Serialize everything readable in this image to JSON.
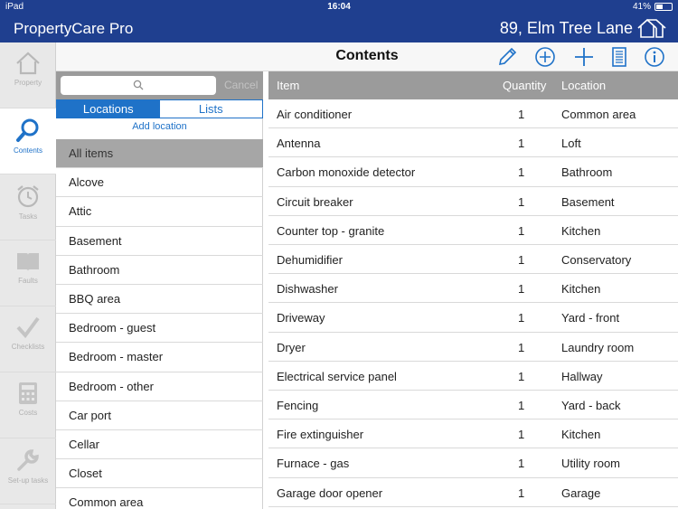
{
  "status": {
    "device": "iPad",
    "time": "16:04",
    "battery": "41%"
  },
  "app": {
    "title": "PropertyCare Pro",
    "address": "89, Elm Tree Lane"
  },
  "rail": [
    {
      "label": "Property",
      "icon": "house-icon"
    },
    {
      "label": "Contents",
      "icon": "magnifier-icon",
      "active": true
    },
    {
      "label": "Tasks",
      "icon": "alarm-clock-icon"
    },
    {
      "label": "Faults",
      "icon": "book-icon"
    },
    {
      "label": "Checklists",
      "icon": "checkmark-icon"
    },
    {
      "label": "Costs",
      "icon": "calculator-icon"
    },
    {
      "label": "Set-up tasks",
      "icon": "wrench-icon"
    }
  ],
  "toolbar": {
    "title": "Contents",
    "icons": [
      "pencil-icon",
      "add-circle-icon",
      "plus-icon",
      "report-icon",
      "info-icon"
    ]
  },
  "search": {
    "placeholder": "",
    "cancel_label": "Cancel"
  },
  "segments": {
    "locations": "Locations",
    "lists": "Lists"
  },
  "add_location": "Add location",
  "locations": [
    "All items",
    "Alcove",
    "Attic",
    "Basement",
    "Bathroom",
    "BBQ area",
    "Bedroom - guest",
    "Bedroom - master",
    "Bedroom - other",
    "Car port",
    "Cellar",
    "Closet",
    "Common area"
  ],
  "table": {
    "headers": {
      "item": "Item",
      "quantity": "Quantity",
      "location": "Location"
    },
    "rows": [
      {
        "item": "Air conditioner",
        "quantity": "1",
        "location": "Common area"
      },
      {
        "item": "Antenna",
        "quantity": "1",
        "location": "Loft"
      },
      {
        "item": "Carbon monoxide detector",
        "quantity": "1",
        "location": "Bathroom"
      },
      {
        "item": "Circuit breaker",
        "quantity": "1",
        "location": "Basement"
      },
      {
        "item": "Counter top - granite",
        "quantity": "1",
        "location": "Kitchen"
      },
      {
        "item": "Dehumidifier",
        "quantity": "1",
        "location": "Conservatory"
      },
      {
        "item": "Dishwasher",
        "quantity": "1",
        "location": "Kitchen"
      },
      {
        "item": "Driveway",
        "quantity": "1",
        "location": "Yard - front"
      },
      {
        "item": "Dryer",
        "quantity": "1",
        "location": "Laundry room"
      },
      {
        "item": "Electrical service panel",
        "quantity": "1",
        "location": "Hallway"
      },
      {
        "item": "Fencing",
        "quantity": "1",
        "location": "Yard - back"
      },
      {
        "item": "Fire extinguisher",
        "quantity": "1",
        "location": "Kitchen"
      },
      {
        "item": "Furnace - gas",
        "quantity": "1",
        "location": "Utility room"
      },
      {
        "item": "Garage door opener",
        "quantity": "1",
        "location": "Garage"
      }
    ]
  },
  "colors": {
    "brand": "#1f3f8f",
    "accent": "#1f72c8",
    "header_gray": "#9b9b9b"
  }
}
